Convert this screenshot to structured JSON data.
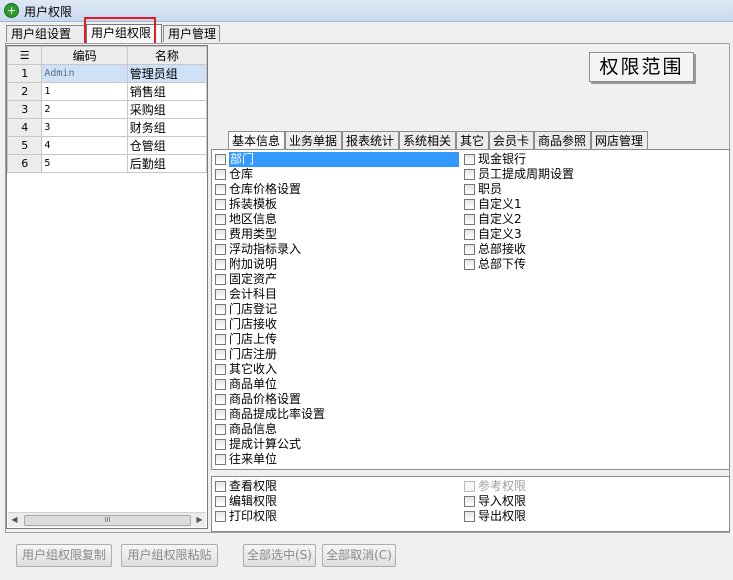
{
  "window": {
    "title": "用户权限"
  },
  "tabs": [
    {
      "label": "用户组设置"
    },
    {
      "label": "用户组权限"
    },
    {
      "label": "用户管理"
    }
  ],
  "grid": {
    "header": {
      "code": "编码",
      "name": "名称"
    },
    "rows": [
      {
        "num": "1",
        "code": "Admin",
        "name": "管理员组"
      },
      {
        "num": "2",
        "code": "1",
        "name": "销售组"
      },
      {
        "num": "3",
        "code": "2",
        "name": "采购组"
      },
      {
        "num": "4",
        "code": "3",
        "name": "财务组"
      },
      {
        "num": "5",
        "code": "4",
        "name": "仓管组"
      },
      {
        "num": "6",
        "code": "5",
        "name": "后勤组"
      }
    ],
    "scroll_thumb_text": "III"
  },
  "scope_label": "权限范围",
  "subtabs": [
    {
      "label": "基本信息"
    },
    {
      "label": "业务单据"
    },
    {
      "label": "报表统计"
    },
    {
      "label": "系统相关"
    },
    {
      "label": "其它"
    },
    {
      "label": "会员卡"
    },
    {
      "label": "商品参照"
    },
    {
      "label": "网店管理"
    }
  ],
  "permissions_left": [
    {
      "label": "部门"
    },
    {
      "label": "仓库"
    },
    {
      "label": "仓库价格设置"
    },
    {
      "label": "拆装模板"
    },
    {
      "label": "地区信息"
    },
    {
      "label": "费用类型"
    },
    {
      "label": "浮动指标录入"
    },
    {
      "label": "附加说明"
    },
    {
      "label": "固定资产"
    },
    {
      "label": "会计科目"
    },
    {
      "label": "门店登记"
    },
    {
      "label": "门店接收"
    },
    {
      "label": "门店上传"
    },
    {
      "label": "门店注册"
    },
    {
      "label": "其它收入"
    },
    {
      "label": "商品单位"
    },
    {
      "label": "商品价格设置"
    },
    {
      "label": "商品提成比率设置"
    },
    {
      "label": "商品信息"
    },
    {
      "label": "提成计算公式"
    },
    {
      "label": "往来单位"
    }
  ],
  "permissions_right": [
    {
      "label": "现金银行"
    },
    {
      "label": "员工提成周期设置"
    },
    {
      "label": "职员"
    },
    {
      "label": "自定义1"
    },
    {
      "label": "自定义2"
    },
    {
      "label": "自定义3"
    },
    {
      "label": "总部接收"
    },
    {
      "label": "总部下传"
    }
  ],
  "rights_left": [
    {
      "label": "查看权限"
    },
    {
      "label": "编辑权限"
    },
    {
      "label": "打印权限"
    }
  ],
  "rights_right": [
    {
      "label": "参考权限"
    },
    {
      "label": "导入权限"
    },
    {
      "label": "导出权限"
    }
  ],
  "buttons": {
    "copy": "用户组权限复制",
    "paste": "用户组权限粘贴",
    "select_all": "全部选中(S)",
    "deselect_all": "全部取消(C)"
  },
  "colors": {
    "highlight": "#3399ff",
    "annotation": "#e51c23"
  }
}
